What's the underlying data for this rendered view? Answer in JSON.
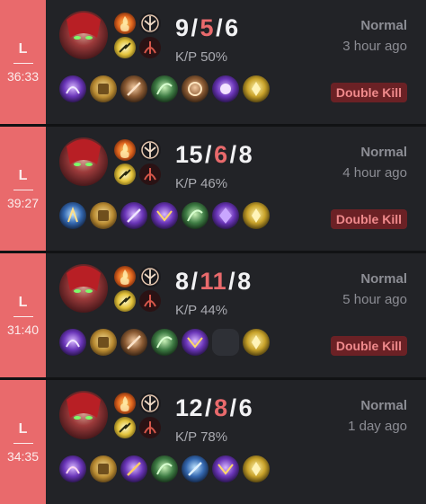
{
  "colors": {
    "loss": "#e96a6c",
    "card_bg": "#222327",
    "page_bg": "#111214",
    "deaths": "#e96a6c",
    "badge_bg": "#6b2125",
    "badge_text": "#f08a8c"
  },
  "matches": [
    {
      "result": "L",
      "duration": "36:33",
      "champion_icon": "katarina-portrait",
      "spells": [
        "ignite-spell-icon",
        "flash-spell-icon"
      ],
      "runes": [
        "electrocute-rune-icon",
        "domination-rune-icon"
      ],
      "kills": "9",
      "deaths": "5",
      "assists": "6",
      "kp": "K/P 50%",
      "queue": "Normal",
      "time_ago": "3 hour ago",
      "badge": "Double Kill",
      "items": [
        "item-1",
        "item-2",
        "item-3",
        "item-4",
        "item-5",
        "item-6",
        "ward-item"
      ]
    },
    {
      "result": "L",
      "duration": "39:27",
      "champion_icon": "katarina-portrait",
      "spells": [
        "ignite-spell-icon",
        "flash-spell-icon"
      ],
      "runes": [
        "electrocute-rune-icon",
        "domination-rune-icon"
      ],
      "kills": "15",
      "deaths": "6",
      "assists": "8",
      "kp": "K/P 46%",
      "queue": "Normal",
      "time_ago": "4 hour ago",
      "badge": "Double Kill",
      "items": [
        "item-1",
        "item-2",
        "item-3",
        "item-4",
        "item-5",
        "item-6",
        "ward-item"
      ]
    },
    {
      "result": "L",
      "duration": "31:40",
      "champion_icon": "katarina-portrait",
      "spells": [
        "ignite-spell-icon",
        "flash-spell-icon"
      ],
      "runes": [
        "electrocute-rune-icon",
        "domination-rune-icon"
      ],
      "kills": "8",
      "deaths": "11",
      "assists": "8",
      "kp": "K/P 44%",
      "queue": "Normal",
      "time_ago": "5 hour ago",
      "badge": "Double Kill",
      "items": [
        "item-1",
        "item-2",
        "item-3",
        "item-4",
        "item-5",
        "empty",
        "ward-item"
      ]
    },
    {
      "result": "L",
      "duration": "34:35",
      "champion_icon": "katarina-portrait",
      "spells": [
        "ignite-spell-icon",
        "flash-spell-icon"
      ],
      "runes": [
        "electrocute-rune-icon",
        "domination-rune-icon"
      ],
      "kills": "12",
      "deaths": "8",
      "assists": "6",
      "kp": "K/P 78%",
      "queue": "Normal",
      "time_ago": "1 day ago",
      "badge": "",
      "items": [
        "item-1",
        "item-2",
        "item-3",
        "item-4",
        "item-5",
        "item-6",
        "ward-item"
      ]
    }
  ]
}
